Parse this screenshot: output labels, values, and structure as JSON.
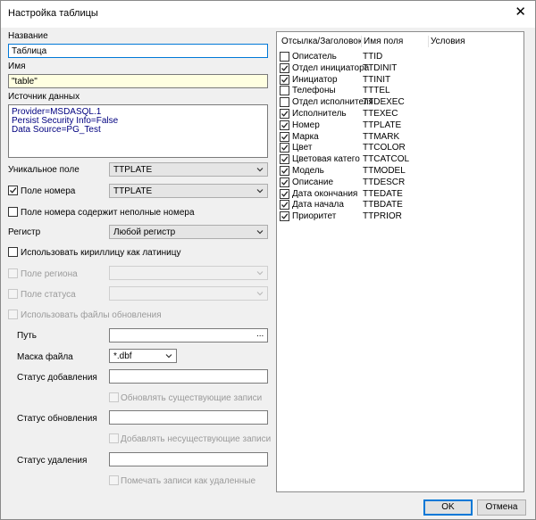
{
  "window": {
    "title": "Настройка таблицы",
    "close_glyph": "✕"
  },
  "form": {
    "name_label": "Название",
    "name_value": "Таблица",
    "alias_label": "Имя",
    "alias_value": "\"table\"",
    "datasource_label": "Источник данных",
    "datasource_lines": [
      "Provider=MSDASQL.1",
      "Persist Security Info=False",
      "Data Source=PG_Test"
    ],
    "unique_field_label": "Уникальное поле",
    "unique_field_value": "TTPLATE",
    "number_field_label": "Поле номера",
    "number_field_checked": true,
    "number_field_value": "TTPLATE",
    "partial_numbers_label": "Поле номера содержит неполные номера",
    "register_label": "Регистр",
    "register_value": "Любой регистр",
    "cyrillic_label": "Использовать кириллицу как латиницу",
    "region_label": "Поле региона",
    "status_field_label": "Поле статуса",
    "update_files_label": "Использовать файлы обновления",
    "path_label": "Путь",
    "path_value": "",
    "path_browse": "...",
    "mask_label": "Маска файла",
    "mask_value": "*.dbf",
    "add_status_label": "Статус добавления",
    "update_existing_label": "Обновлять существующие записи",
    "update_status_label": "Статус обновления",
    "add_missing_label": "Добавлять несуществующие записи",
    "delete_status_label": "Статус удаления",
    "mark_deleted_label": "Помечать записи как удаленные"
  },
  "list": {
    "headers": [
      "Отсылка/Заголовок",
      "Имя поля",
      "Условия"
    ],
    "rows": [
      {
        "checked": false,
        "title": "Описатель",
        "field": "TTID"
      },
      {
        "checked": true,
        "title": "Отдел инициатора",
        "field": "TTDINIT"
      },
      {
        "checked": true,
        "title": "Инициатор",
        "field": "TTINIT"
      },
      {
        "checked": false,
        "title": "Телефоны",
        "field": "TTTEL"
      },
      {
        "checked": false,
        "title": "Отдел исполнителя",
        "field": "TTDEXEC"
      },
      {
        "checked": true,
        "title": "Исполнитель",
        "field": "TTEXEC"
      },
      {
        "checked": true,
        "title": "Номер",
        "field": "TTPLATE"
      },
      {
        "checked": true,
        "title": "Марка",
        "field": "TTMARK"
      },
      {
        "checked": true,
        "title": "Цвет",
        "field": "TTCOLOR"
      },
      {
        "checked": true,
        "title": "Цветовая катего",
        "field": "TTCATCOL"
      },
      {
        "checked": true,
        "title": "Модель",
        "field": "TTMODEL"
      },
      {
        "checked": true,
        "title": "Описание",
        "field": "TTDESCR"
      },
      {
        "checked": true,
        "title": "Дата окончания",
        "field": "TTEDATE"
      },
      {
        "checked": true,
        "title": "Дата начала",
        "field": "TTBDATE"
      },
      {
        "checked": true,
        "title": "Приоритет",
        "field": "TTPRIOR"
      }
    ]
  },
  "buttons": {
    "ok": "OK",
    "cancel": "Отмена"
  },
  "colors": {
    "accent": "#0078d7",
    "highlight_input": "#ffffe1",
    "connection_text": "#000080"
  }
}
